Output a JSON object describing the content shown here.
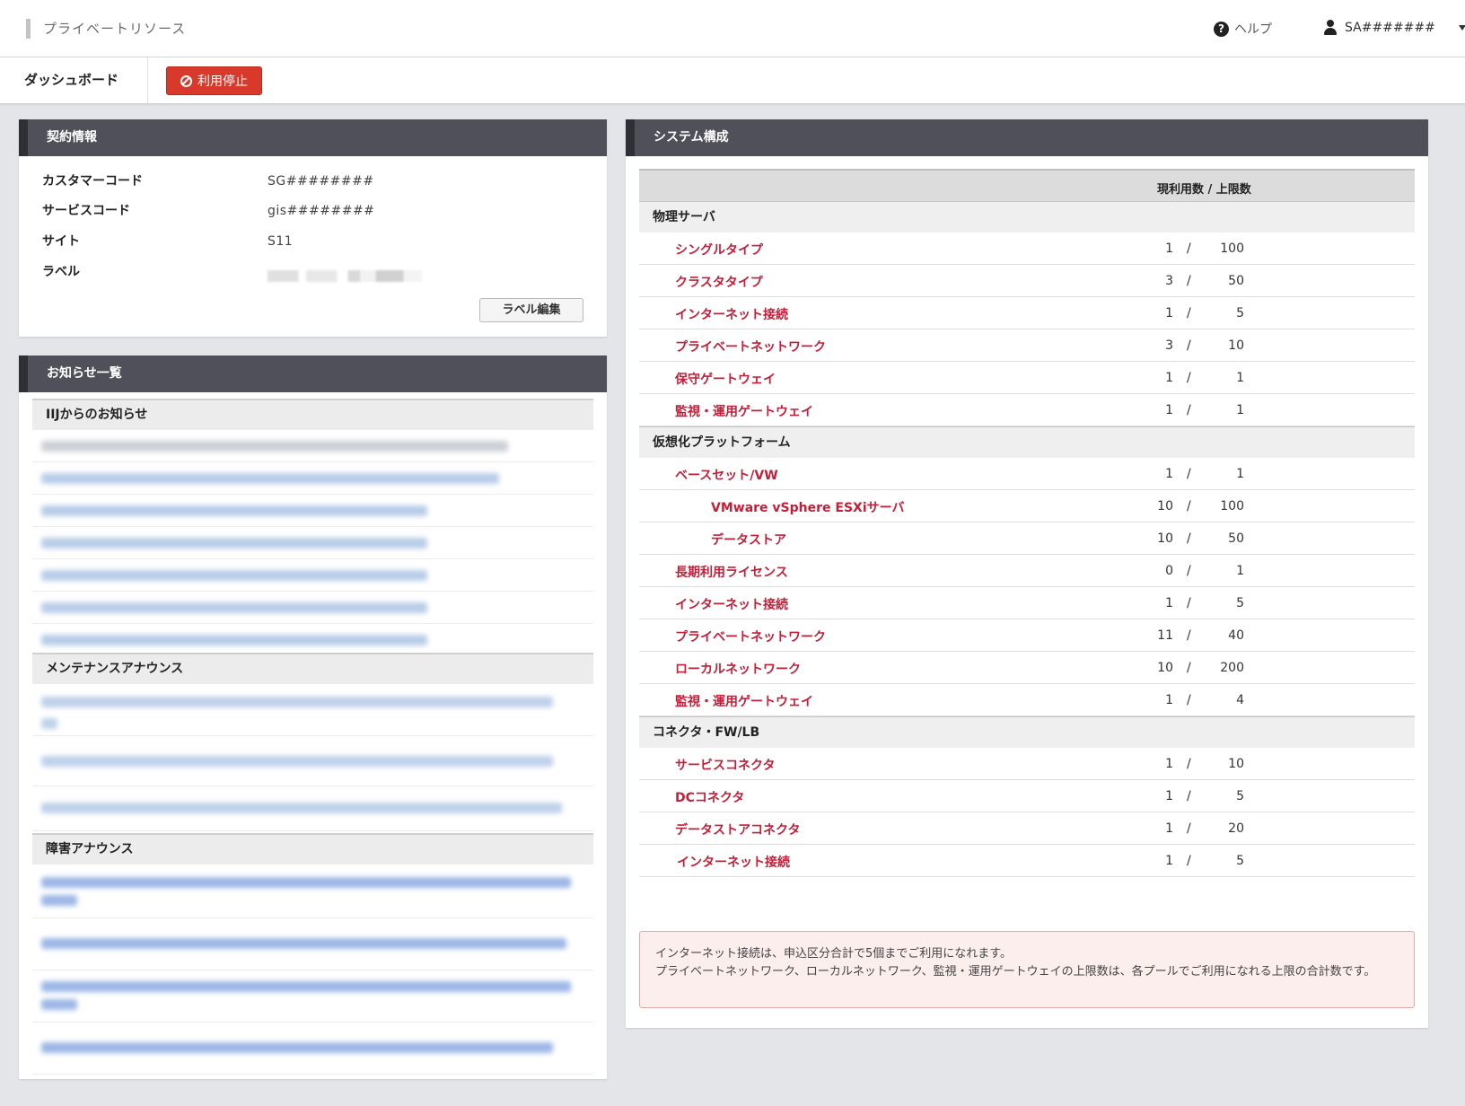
{
  "header": {
    "app_title": "プライベートリソース",
    "help_label": "ヘルプ",
    "user_name": "SA#######"
  },
  "subnav": {
    "dashboard_label": "ダッシュボード",
    "stop_button_label": "利用停止"
  },
  "contract": {
    "title": "契約情報",
    "rows": [
      {
        "label": "カスタマーコード",
        "value": "SG########"
      },
      {
        "label": "サービスコード",
        "value": "gis########"
      },
      {
        "label": "サイト",
        "value": "S11"
      },
      {
        "label": "ラベル",
        "value": ""
      }
    ],
    "edit_button_label": "ラベル編集"
  },
  "notices": {
    "title": "お知らせ一覧",
    "sections": [
      {
        "title": "IIJからのお知らせ"
      },
      {
        "title": "メンテナンスアナウンス"
      },
      {
        "title": "障害アナウンス"
      }
    ]
  },
  "system": {
    "title": "システム構成",
    "column_header": "現利用数 / 上限数",
    "groups": [
      {
        "title": "物理サーバ",
        "rows": [
          {
            "name": "シングルタイプ",
            "current": "1",
            "max": "100"
          },
          {
            "name": "クラスタタイプ",
            "current": "3",
            "max": "50"
          },
          {
            "name": "インターネット接続",
            "current": "1",
            "max": "5"
          },
          {
            "name": "プライベートネットワーク",
            "current": "3",
            "max": "10"
          },
          {
            "name": "保守ゲートウェイ",
            "current": "1",
            "max": "1"
          },
          {
            "name": "監視・運用ゲートウェイ",
            "current": "1",
            "max": "1"
          }
        ]
      },
      {
        "title": "仮想化プラットフォーム",
        "rows": [
          {
            "name": "ベースセット/VW",
            "current": "1",
            "max": "1"
          },
          {
            "name": "VMware vSphere ESXiサーバ",
            "current": "10",
            "max": "100"
          },
          {
            "name": "データストア",
            "current": "10",
            "max": "50"
          },
          {
            "name": "長期利用ライセンス",
            "current": "0",
            "max": "1"
          },
          {
            "name": "インターネット接続",
            "current": "1",
            "max": "5"
          },
          {
            "name": "プライベートネットワーク",
            "current": "11",
            "max": "40"
          },
          {
            "name": "ローカルネットワーク",
            "current": "10",
            "max": "200"
          },
          {
            "name": "監視・運用ゲートウェイ",
            "current": "1",
            "max": "4"
          }
        ]
      },
      {
        "title": "コネクタ・FW/LB",
        "rows": [
          {
            "name": "サービスコネクタ",
            "current": "1",
            "max": "10"
          },
          {
            "name": "DCコネクタ",
            "current": "1",
            "max": "5"
          },
          {
            "name": "データストアコネクタ",
            "current": "1",
            "max": "20"
          },
          {
            "name": "インターネット接続",
            "current": "1",
            "max": "5"
          }
        ]
      }
    ],
    "separator": "/",
    "note_lines": [
      "インターネット接続は、申込区分合計で5個までご利用になれます。",
      "プライベートネットワーク、ローカルネットワーク、監視・運用ゲートウェイの上限数は、各プールでご利用になれる上限の合計数です。"
    ]
  },
  "colors": {
    "accent_red": "#d9392b",
    "link_red": "#c21f39",
    "panel_header": "#50505a"
  }
}
